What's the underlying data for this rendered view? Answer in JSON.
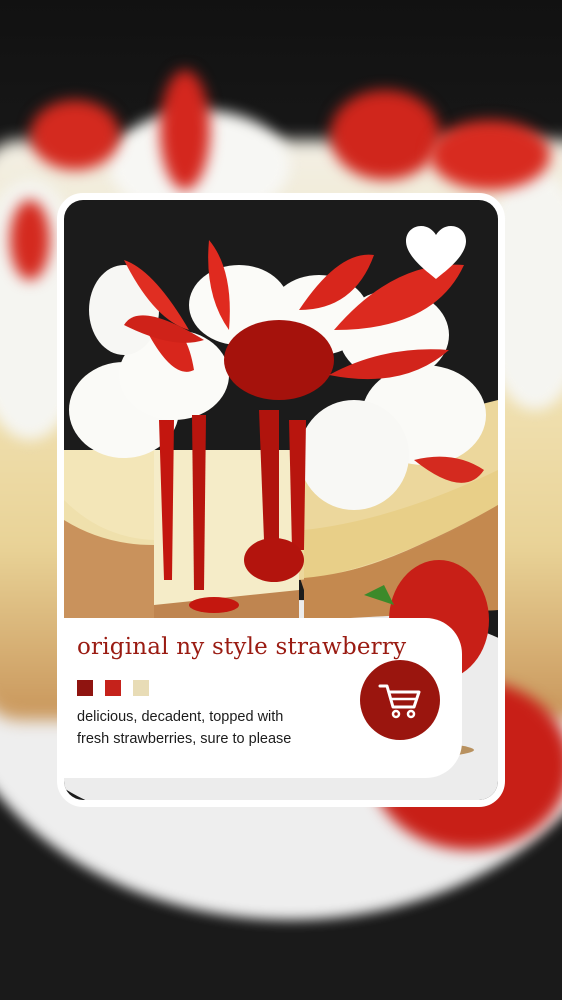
{
  "card": {
    "title": "original ny style strawberry",
    "description_line1": "delicious, decadent, topped with",
    "description_line2": "fresh strawberries, sure to please",
    "swatches": [
      "#8f1410",
      "#c5221b",
      "#e8dcb6"
    ]
  },
  "icons": {
    "favorite": "heart-icon",
    "cart": "shopping-cart-icon"
  },
  "colors": {
    "accent": "#9a150e",
    "title": "#9a1b12"
  }
}
